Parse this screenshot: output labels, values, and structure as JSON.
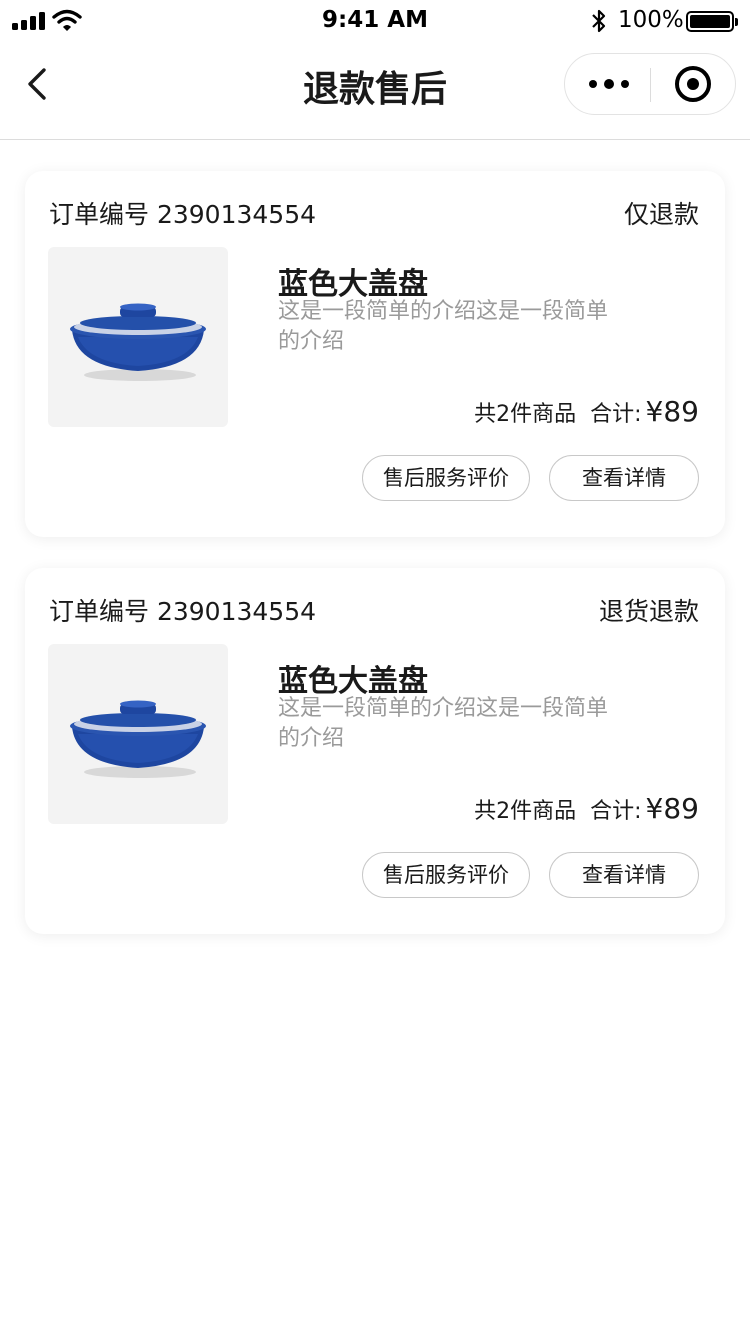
{
  "status_bar": {
    "time": "9:41 AM",
    "battery": "100%"
  },
  "nav": {
    "title": "退款售后"
  },
  "orders": [
    {
      "order_no": "订单编号 2390134554",
      "refund_type": "仅退款",
      "product_name": "蓝色大盖盘",
      "product_desc": "这是一段简单的介绍这是一段简单的介绍",
      "item_count": "共2件商品",
      "total_label": "合计:",
      "price": "¥89",
      "review_button": "售后服务评价",
      "detail_button": "查看详情"
    },
    {
      "order_no": "订单编号 2390134554",
      "refund_type": "退货退款",
      "product_name": "蓝色大盖盘",
      "product_desc": "这是一段简单的介绍这是一段简单的介绍",
      "item_count": "共2件商品",
      "total_label": "合计:",
      "price": "¥89",
      "review_button": "售后服务评价",
      "detail_button": "查看详情"
    }
  ],
  "colors": {
    "pot_blue": "#1e46a0",
    "background": "#ffffff",
    "secondary_text": "#9a9a9a"
  }
}
